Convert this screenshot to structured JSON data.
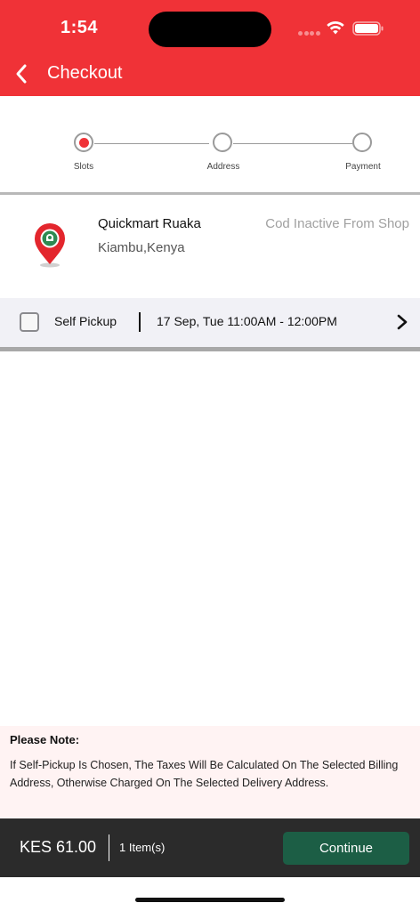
{
  "status_bar": {
    "time": "1:54"
  },
  "header": {
    "title": "Checkout",
    "back_icon": "chevron-left-icon",
    "background_color": "#f03237"
  },
  "stepper": {
    "steps": [
      {
        "label": "Slots",
        "active": true
      },
      {
        "label": "Address",
        "active": false
      },
      {
        "label": "Payment",
        "active": false
      }
    ]
  },
  "shop": {
    "name": "Quickmart Ruaka",
    "location": "Kiambu,Kenya",
    "cod_status": "Cod Inactive From Shop",
    "logo_icon": "map-pin-icon"
  },
  "pickup": {
    "checkbox_checked": false,
    "label": "Self Pickup",
    "slot": "17 Sep, Tue 11:00AM - 12:00PM",
    "action_icon": "chevron-right-icon"
  },
  "note": {
    "title": "Please Note:",
    "text": "If Self-Pickup Is Chosen, The Taxes Will Be Calculated On The Selected Billing Address, Otherwise Charged On The Selected Delivery Address."
  },
  "footer": {
    "total": "KES 61.00",
    "items": "1 Item(s)",
    "continue_label": "Continue",
    "continue_color": "#1c5e45"
  }
}
